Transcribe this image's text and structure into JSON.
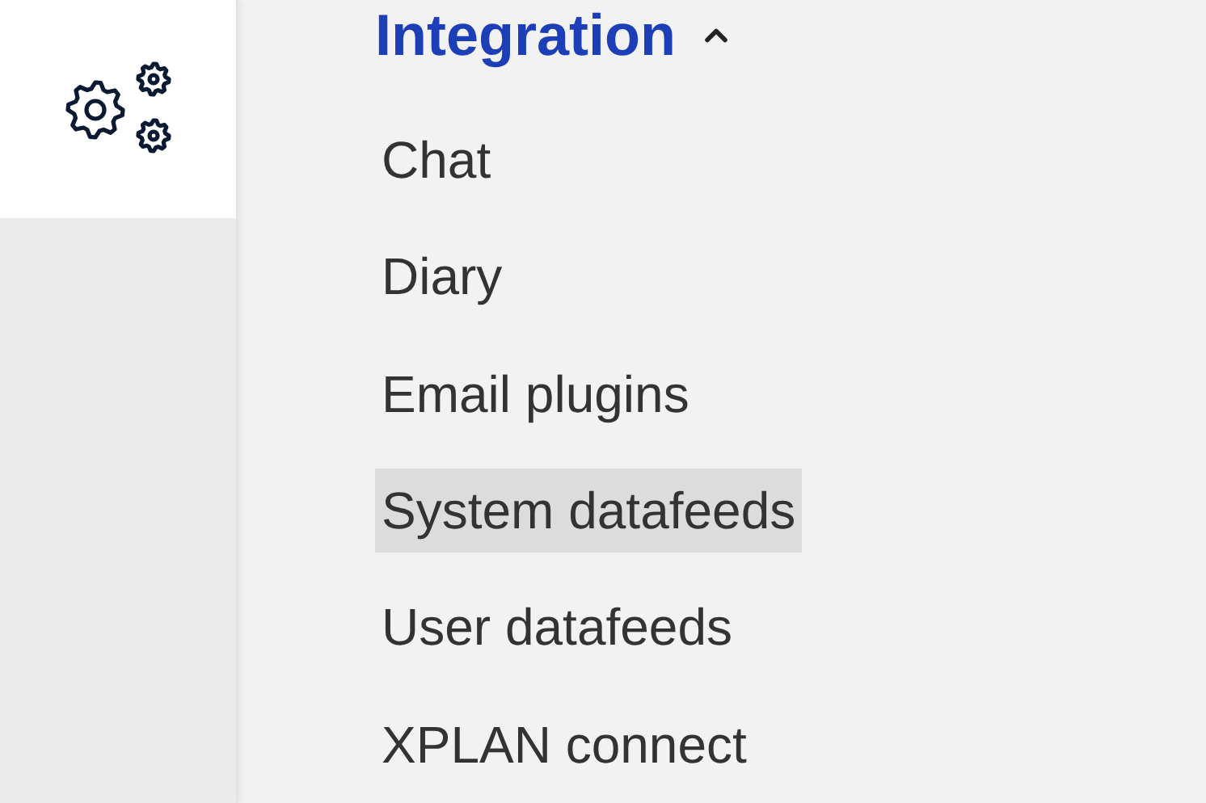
{
  "section": {
    "title": "Integration",
    "expanded": true
  },
  "items": [
    {
      "label": "Chat",
      "selected": false
    },
    {
      "label": "Diary",
      "selected": false
    },
    {
      "label": "Email plugins",
      "selected": false
    },
    {
      "label": "System datafeeds",
      "selected": true
    },
    {
      "label": "User datafeeds",
      "selected": false
    },
    {
      "label": "XPLAN connect",
      "selected": false
    }
  ]
}
